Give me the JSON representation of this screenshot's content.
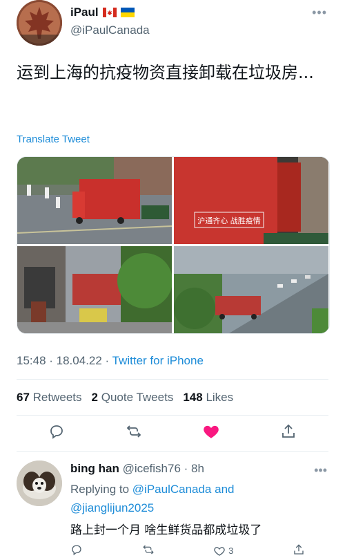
{
  "author": {
    "name": "iPaul",
    "handle": "@iPaulCanada"
  },
  "tweet": {
    "text": "运到上海的抗疫物资直接卸载在垃圾房...",
    "translate_label": "Translate Tweet",
    "time": "15:48 · 18.04.22 · ",
    "source": "Twitter for iPhone",
    "banner_text": "沪通齐心 战胜疫情"
  },
  "stats": {
    "retweets_count": "67",
    "retweets_label": "Retweets",
    "quotes_count": "2",
    "quotes_label": "Quote Tweets",
    "likes_count": "148",
    "likes_label": "Likes"
  },
  "reply": {
    "name": "bing han",
    "handle": "@icefish76 · 8h",
    "replying_prefix": "Replying to ",
    "replying_user1": "@iPaulCanada",
    "replying_and": " and",
    "replying_user2": "@jianglijun2025",
    "text": "路上封一个月 啥生鲜货品都成垃圾了",
    "like_count": "3"
  },
  "colors": {
    "link": "#1d8cd8",
    "like": "#f91880",
    "muted": "#536471"
  },
  "icons": [
    "more-icon",
    "canada-flag-icon",
    "ukraine-flag-icon",
    "reply-icon",
    "retweet-icon",
    "like-icon",
    "share-icon"
  ]
}
